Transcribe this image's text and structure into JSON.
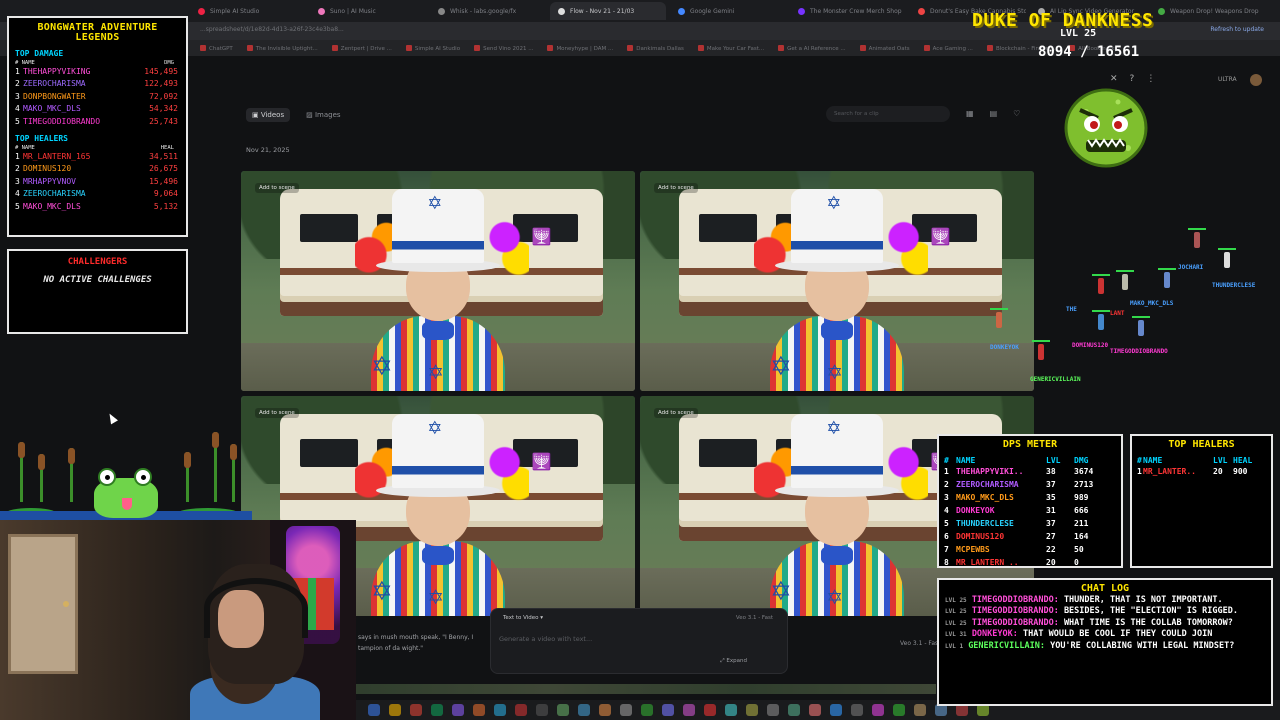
{
  "browser": {
    "tabs": [
      {
        "label": "Simple AI Studio",
        "color": "#e24"
      },
      {
        "label": "Suno | AI Music",
        "color": "#e7b"
      },
      {
        "label": "Whisk - labs.google/fx",
        "color": "#888"
      },
      {
        "label": "Flow - Nov 21 - 21/03",
        "color": "#ddd",
        "active": true
      },
      {
        "label": "Google Gemini",
        "color": "#48f"
      },
      {
        "label": "The Monster Crew Merch Shop",
        "color": "#73f"
      },
      {
        "label": "Donut's Easy Bake Cannabis Store",
        "color": "#e44"
      },
      {
        "label": "AI Lip Sync Video Generator",
        "color": "#aaa"
      },
      {
        "label": "Weapon Drop! Weapons Drop",
        "color": "#4a4"
      }
    ],
    "url": "...spreadsheet/d/1e82d-4d13-a26f-23c4e3ba8...",
    "refresh_label": "Refresh to update",
    "bookmarks": [
      "ChatGPT",
      "The Invisible Uptight...",
      "Zentpert | Drive ...",
      "Simple AI Studio",
      "Send Vino 2021 ...",
      "Moneyhype | DAM ...",
      "Dankimals Dallas",
      "Make Your Car Fast...",
      "Get a AI Reference ...",
      "Animated Oats",
      "Ace Gaming ...",
      "Blockchain - Finder ...",
      "All Bookmarks"
    ]
  },
  "app": {
    "tabs": {
      "videos": "Videos",
      "images": "Images"
    },
    "search_placeholder": "Search for a clip",
    "date": "Nov 21, 2025",
    "add_to_scene": "Add to scene",
    "ultra_label": "ULTRA",
    "prompt_excerpt": "says in mush mouth speak, \"I Benny, I tampion of da wight.\"",
    "prompt_mode": "Text to Video",
    "prompt_model": "Veo 3.1 - Fast",
    "prompt_placeholder": "Generate a video with text...",
    "expand_label": "Expand",
    "model_side": "Veo 3.1 - Fast"
  },
  "legends": {
    "title": "BONGWATER ADVENTURE LEGENDS",
    "damage": {
      "title": "TOP DAMAGE",
      "col_name": "# NAME",
      "col_value": "DMG",
      "rows": [
        {
          "rank": "1",
          "name": "THEHAPPYVIKING",
          "value": "145,495"
        },
        {
          "rank": "2",
          "name": "ZEEROCHARISMA",
          "value": "122,493"
        },
        {
          "rank": "3",
          "name": "DONPBONGWATER",
          "value": "72,092"
        },
        {
          "rank": "4",
          "name": "MAKO_MKC_DLS",
          "value": "54,342"
        },
        {
          "rank": "5",
          "name": "TIMEGODDIOBRANDO",
          "value": "25,743"
        }
      ]
    },
    "healers": {
      "title": "TOP HEALERS",
      "col_name": "# NAME",
      "col_value": "HEAL",
      "rows": [
        {
          "rank": "1",
          "name": "MR_LANTERN_165",
          "value": "34,511"
        },
        {
          "rank": "2",
          "name": "DOMINUS120",
          "value": "26,675"
        },
        {
          "rank": "3",
          "name": "MRHAPPYVNOV",
          "value": "15,496"
        },
        {
          "rank": "4",
          "name": "ZEEROCHARISMA",
          "value": "9,064"
        },
        {
          "rank": "5",
          "name": "MAKO_MKC_DLS",
          "value": "5,132"
        }
      ]
    }
  },
  "challengers": {
    "title": "CHALLENGERS",
    "status": "NO ACTIVE CHALLENGES"
  },
  "boss": {
    "name": "DUKE OF DANKNESS",
    "level": "LVL 25",
    "hp": "8094 / 16561"
  },
  "party": {
    "labels": [
      "JOCHARI",
      "THUNDERCLESE",
      "MAKO_MKC_DLS",
      "THE",
      "LANT",
      "DOMINUS120",
      "TIMEGODDIOBRANDO",
      "DONKEYOK",
      "GENERICVILLAIN"
    ]
  },
  "dps": {
    "title": "DPS METER",
    "head": {
      "rank": "#",
      "name": "NAME",
      "lvl": "LVL",
      "dmg": "DMG"
    },
    "rows": [
      {
        "rank": "1",
        "name": "THEHAPPYVIKI..",
        "lvl": "38",
        "dmg": "3674"
      },
      {
        "rank": "2",
        "name": "ZEEROCHARISMA",
        "lvl": "37",
        "dmg": "2713"
      },
      {
        "rank": "3",
        "name": "MAKO_MKC_DLS",
        "lvl": "35",
        "dmg": "989"
      },
      {
        "rank": "4",
        "name": "DONKEYOK",
        "lvl": "31",
        "dmg": "666"
      },
      {
        "rank": "5",
        "name": "THUNDERCLESE",
        "lvl": "37",
        "dmg": "211"
      },
      {
        "rank": "6",
        "name": "DOMINUS120",
        "lvl": "27",
        "dmg": "164"
      },
      {
        "rank": "7",
        "name": "MCPEWBS",
        "lvl": "22",
        "dmg": "50"
      },
      {
        "rank": "8",
        "name": "MR_LANTERN_..",
        "lvl": "20",
        "dmg": "0"
      }
    ]
  },
  "healers_meter": {
    "title": "TOP HEALERS",
    "head": {
      "rank": "#",
      "name": "NAME",
      "lvl": "LVL",
      "heal": "HEAL"
    },
    "rows": [
      {
        "rank": "1",
        "name": "MR_LANTER..",
        "lvl": "20",
        "heal": "900"
      }
    ]
  },
  "chat": {
    "title": "CHAT LOG",
    "messages": [
      {
        "lvl": "LVL 25",
        "user": "TIMEGODDIOBRANDO:",
        "text": "THUNDER, THAT IS NOT IMPORTANT.",
        "color": "#ff4fd8"
      },
      {
        "lvl": "LVL 25",
        "user": "TIMEGODDIOBRANDO:",
        "text": "BESIDES, THE \"ELECTION\" IS RIGGED.",
        "color": "#ff4fd8"
      },
      {
        "lvl": "LVL 25",
        "user": "TIMEGODDIOBRANDO:",
        "text": "WHAT TIME IS THE COLLAB TOMORROW?",
        "color": "#ff4fd8"
      },
      {
        "lvl": "LVL 31",
        "user": "DONKEYOK:",
        "text": "THAT WOULD BE COOL IF THEY COULD JOIN",
        "color": "#ff3bd2"
      },
      {
        "lvl": "LVL 1",
        "user": "GENERICVILLAIN:",
        "text": "YOU'RE COLLABING WITH LEGAL MINDSET?",
        "color": "#5dff5d"
      }
    ]
  }
}
